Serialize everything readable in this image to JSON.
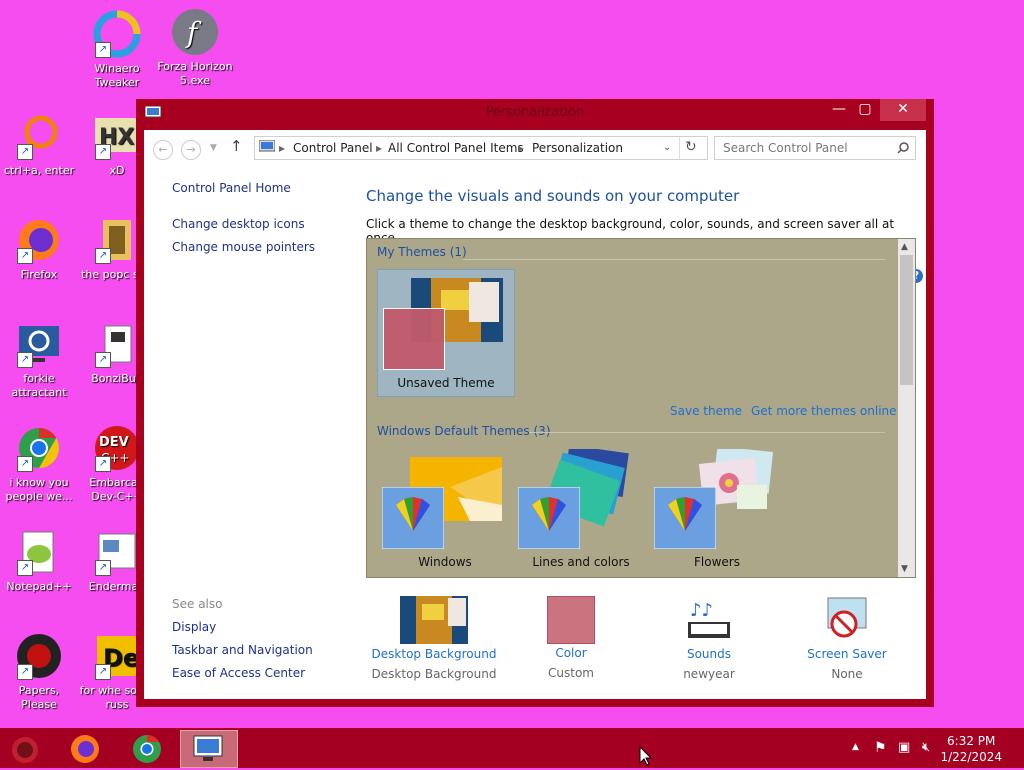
{
  "desktop": {
    "icons": [
      {
        "label": "Winaero Tweaker",
        "icon": "winaero-icon"
      },
      {
        "label": "Forza Horizon 5.exe",
        "icon": "flash-player-icon"
      },
      {
        "label": "ctrl+a, enter",
        "icon": "ring-icon"
      },
      {
        "label": "xD",
        "icon": "hxd-icon"
      },
      {
        "label": "Firefox",
        "icon": "firefox-icon"
      },
      {
        "label": "the popc shit",
        "icon": "media-file-icon"
      },
      {
        "label": "forkie attractant",
        "icon": "settings-monitor-icon"
      },
      {
        "label": "BonziBud",
        "icon": "flag-file-icon"
      },
      {
        "label": "i know you people we...",
        "icon": "chrome-icon"
      },
      {
        "label": "Embarcad Dev-C++",
        "icon": "devcpp-icon"
      },
      {
        "label": "Notepad++",
        "icon": "notepadpp-icon"
      },
      {
        "label": "Enderman",
        "icon": "document-icon"
      },
      {
        "label": "Papers, Please",
        "icon": "papers-please-icon"
      },
      {
        "label": "for whe some russ",
        "icon": "yellow-logo-icon"
      }
    ]
  },
  "window": {
    "title": "Personalization",
    "controls": {
      "minimize": "—",
      "maximize": "▢",
      "close": "✕"
    }
  },
  "address": {
    "crumbs": [
      "Control Panel",
      "All Control Panel Items",
      "Personalization"
    ],
    "search_placeholder": "Search Control Panel"
  },
  "sidebar": {
    "home": "Control Panel Home",
    "links": [
      "Change desktop icons",
      "Change mouse pointers"
    ],
    "see_also_title": "See also",
    "see_also": [
      "Display",
      "Taskbar and Navigation",
      "Ease of Access Center"
    ]
  },
  "main": {
    "heading": "Change the visuals and sounds on your computer",
    "subheading": "Click a theme to change the desktop background, color, sounds, and screen saver all at once.",
    "my_themes_label": "My Themes (1)",
    "unsaved_theme": "Unsaved Theme",
    "save_theme": "Save theme",
    "get_more": "Get more themes online",
    "default_label": "Windows Default Themes (3)",
    "default_themes": [
      "Windows",
      "Lines and colors",
      "Flowers"
    ]
  },
  "bottom": {
    "items": [
      {
        "title": "Desktop Background",
        "value": "Desktop Background"
      },
      {
        "title": "Color",
        "value": "Custom"
      },
      {
        "title": "Sounds",
        "value": "newyear"
      },
      {
        "title": "Screen Saver",
        "value": "None"
      }
    ]
  },
  "taskbar": {
    "time": "6:32 PM",
    "date": "1/22/2024"
  },
  "colors": {
    "desktop": "#f64df0",
    "window_frame": "#a8001f",
    "taskbar": "#a30022",
    "theme_bg": "#ada789",
    "accent_color": "#c06070"
  }
}
